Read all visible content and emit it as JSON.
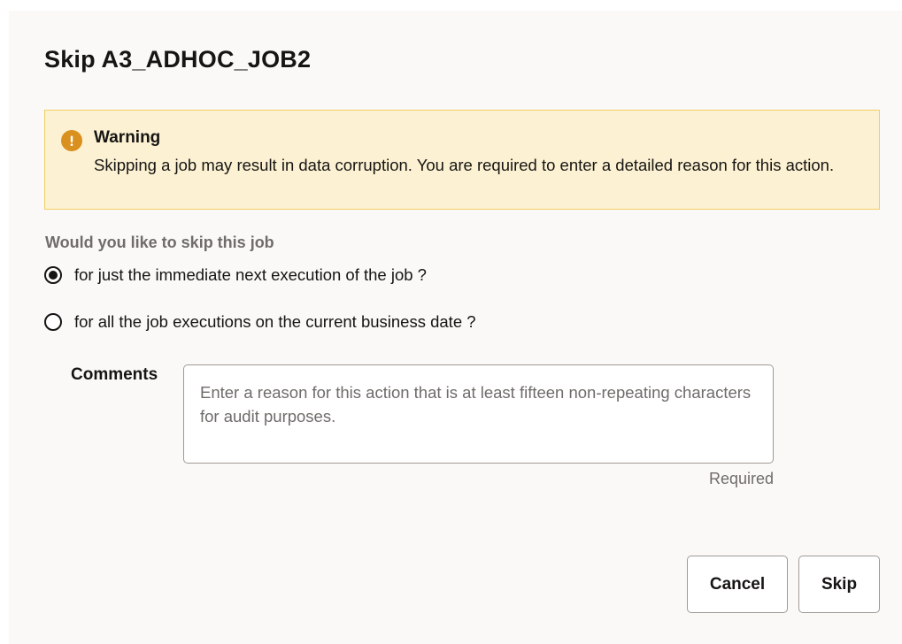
{
  "dialog": {
    "title": "Skip A3_ADHOC_JOB2"
  },
  "warning": {
    "icon": "warning-icon",
    "title": "Warning",
    "message": "Skipping a job may result in data corruption. You are required to enter a detailed reason for this action."
  },
  "skip_options": {
    "question": "Would you like to skip this job",
    "options": [
      {
        "label": "for just the immediate next execution of the job ?",
        "selected": true
      },
      {
        "label": "for all the job executions on the current business date ?",
        "selected": false
      }
    ]
  },
  "comments": {
    "label": "Comments",
    "value": "",
    "placeholder": "Enter a reason for this action that is at least fifteen non-repeating characters for audit purposes.",
    "hint": "Required"
  },
  "buttons": {
    "cancel_label": "Cancel",
    "skip_label": "Skip"
  },
  "colors": {
    "dialog_background": "#fbf9f8",
    "warning_background": "#fcf1d2",
    "warning_border": "#f2cf64",
    "warning_icon": "#d9901e",
    "muted_text": "#6f6c69"
  }
}
